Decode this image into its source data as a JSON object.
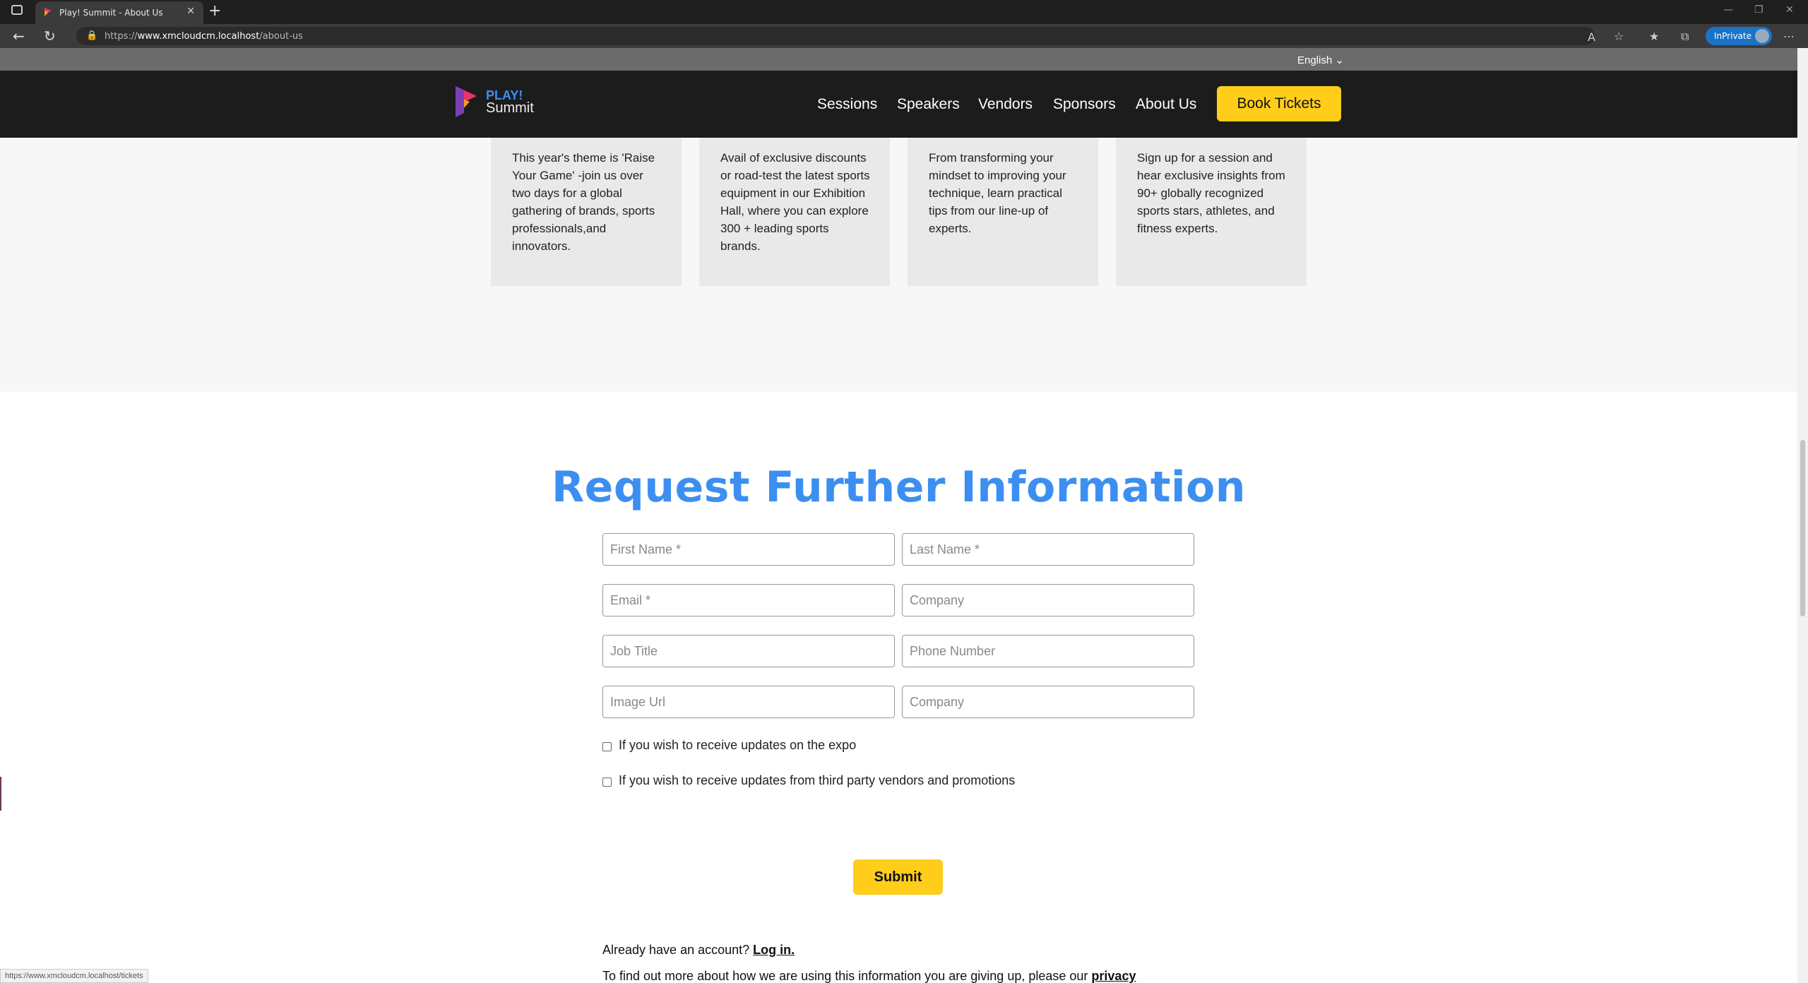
{
  "browser": {
    "tab_title": "Play! Summit - About Us",
    "url_prefix": "https://",
    "url_host": "www.xmcloudcm.localhost",
    "url_path": "/about-us",
    "inprivate_label": "InPrivate",
    "status_url": "https://www.xmcloudcm.localhost/tickets"
  },
  "language": {
    "selected": "English"
  },
  "header": {
    "logo_line1": "PLAY!",
    "logo_line2": "Summit",
    "nav": [
      "Sessions",
      "Speakers",
      "Vendors",
      "Sponsors",
      "About Us"
    ],
    "cta": "Book Tickets"
  },
  "features": [
    {
      "text": "This year's theme is 'Raise Your Game' -join us over two days for a global gathering of brands, sports professionals,and innovators."
    },
    {
      "text": "Avail of exclusive discounts or road-test the latest sports equipment in our Exhibition Hall, where you can explore 300 + leading sports brands."
    },
    {
      "text": "From transforming your mindset to improving your technique, learn practical tips from our line-up of experts."
    },
    {
      "text": "Sign up for a session and hear exclusive insights from 90+ globally recognized sports stars, athletes, and fitness experts."
    }
  ],
  "form": {
    "title": "Request Further Information",
    "fields": {
      "first_name": "First Name *",
      "last_name": "Last Name *",
      "email": "Email *",
      "company": "Company",
      "job_title": "Job Title",
      "phone": "Phone Number",
      "image_url": "Image Url",
      "company2": "Company"
    },
    "checkbox_expo": "If you wish to receive updates on the expo",
    "checkbox_vendors": "If you wish to receive updates from third party vendors and promotions",
    "submit": "Submit",
    "account_text": "Already have an account?",
    "login_link": "Log in.",
    "privacy_text": "To find out more about how we are using this information you are giving up, please our",
    "privacy_link": "privacy statement"
  },
  "colors": {
    "accent_blue": "#3c8ff0",
    "accent_yellow": "#ffcd1a",
    "header_bg": "#1c1c1c"
  }
}
